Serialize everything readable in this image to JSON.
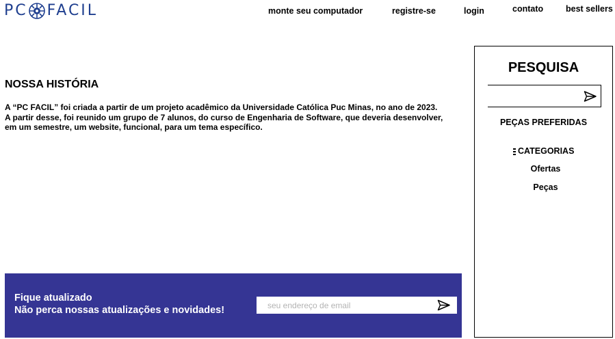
{
  "header": {
    "logo_left": "PC",
    "logo_right": "FACIL",
    "brand_color": "#1f3f8f",
    "nav": {
      "monte": "monte seu computador",
      "registre": "registre-se",
      "login": "login",
      "contato": "contato",
      "best_sellers": "best sellers"
    }
  },
  "main": {
    "title": "NOSSA HISTÓRIA",
    "paragraph_lines": [
      "A “PC FACIL” foi criada a partir de um projeto acadêmico da Universidade Católica Puc Minas, no ano de 2023.",
      "A partir desse, foi reunido um grupo de 7 alunos, do curso de Engenharia de Software, que deveria desenvolver,",
      "em um semestre, um website, funcional, para um tema específico."
    ]
  },
  "sidebar": {
    "title": "PESQUISA",
    "search_value": "",
    "send_icon": "send-icon",
    "pecas_preferidas": "PEÇAS PREFERIDAS",
    "categorias": "CATEGORIAS",
    "categorias_icon": "menu-icon",
    "ofertas": "Ofertas",
    "pecas": "Peças"
  },
  "newsletter": {
    "title": "Fique atualizado",
    "subtitle": "Não perca nossas atualizações e novidades!",
    "placeholder": "seu endereço de email",
    "background_color": "#353594",
    "send_icon": "send-icon"
  }
}
